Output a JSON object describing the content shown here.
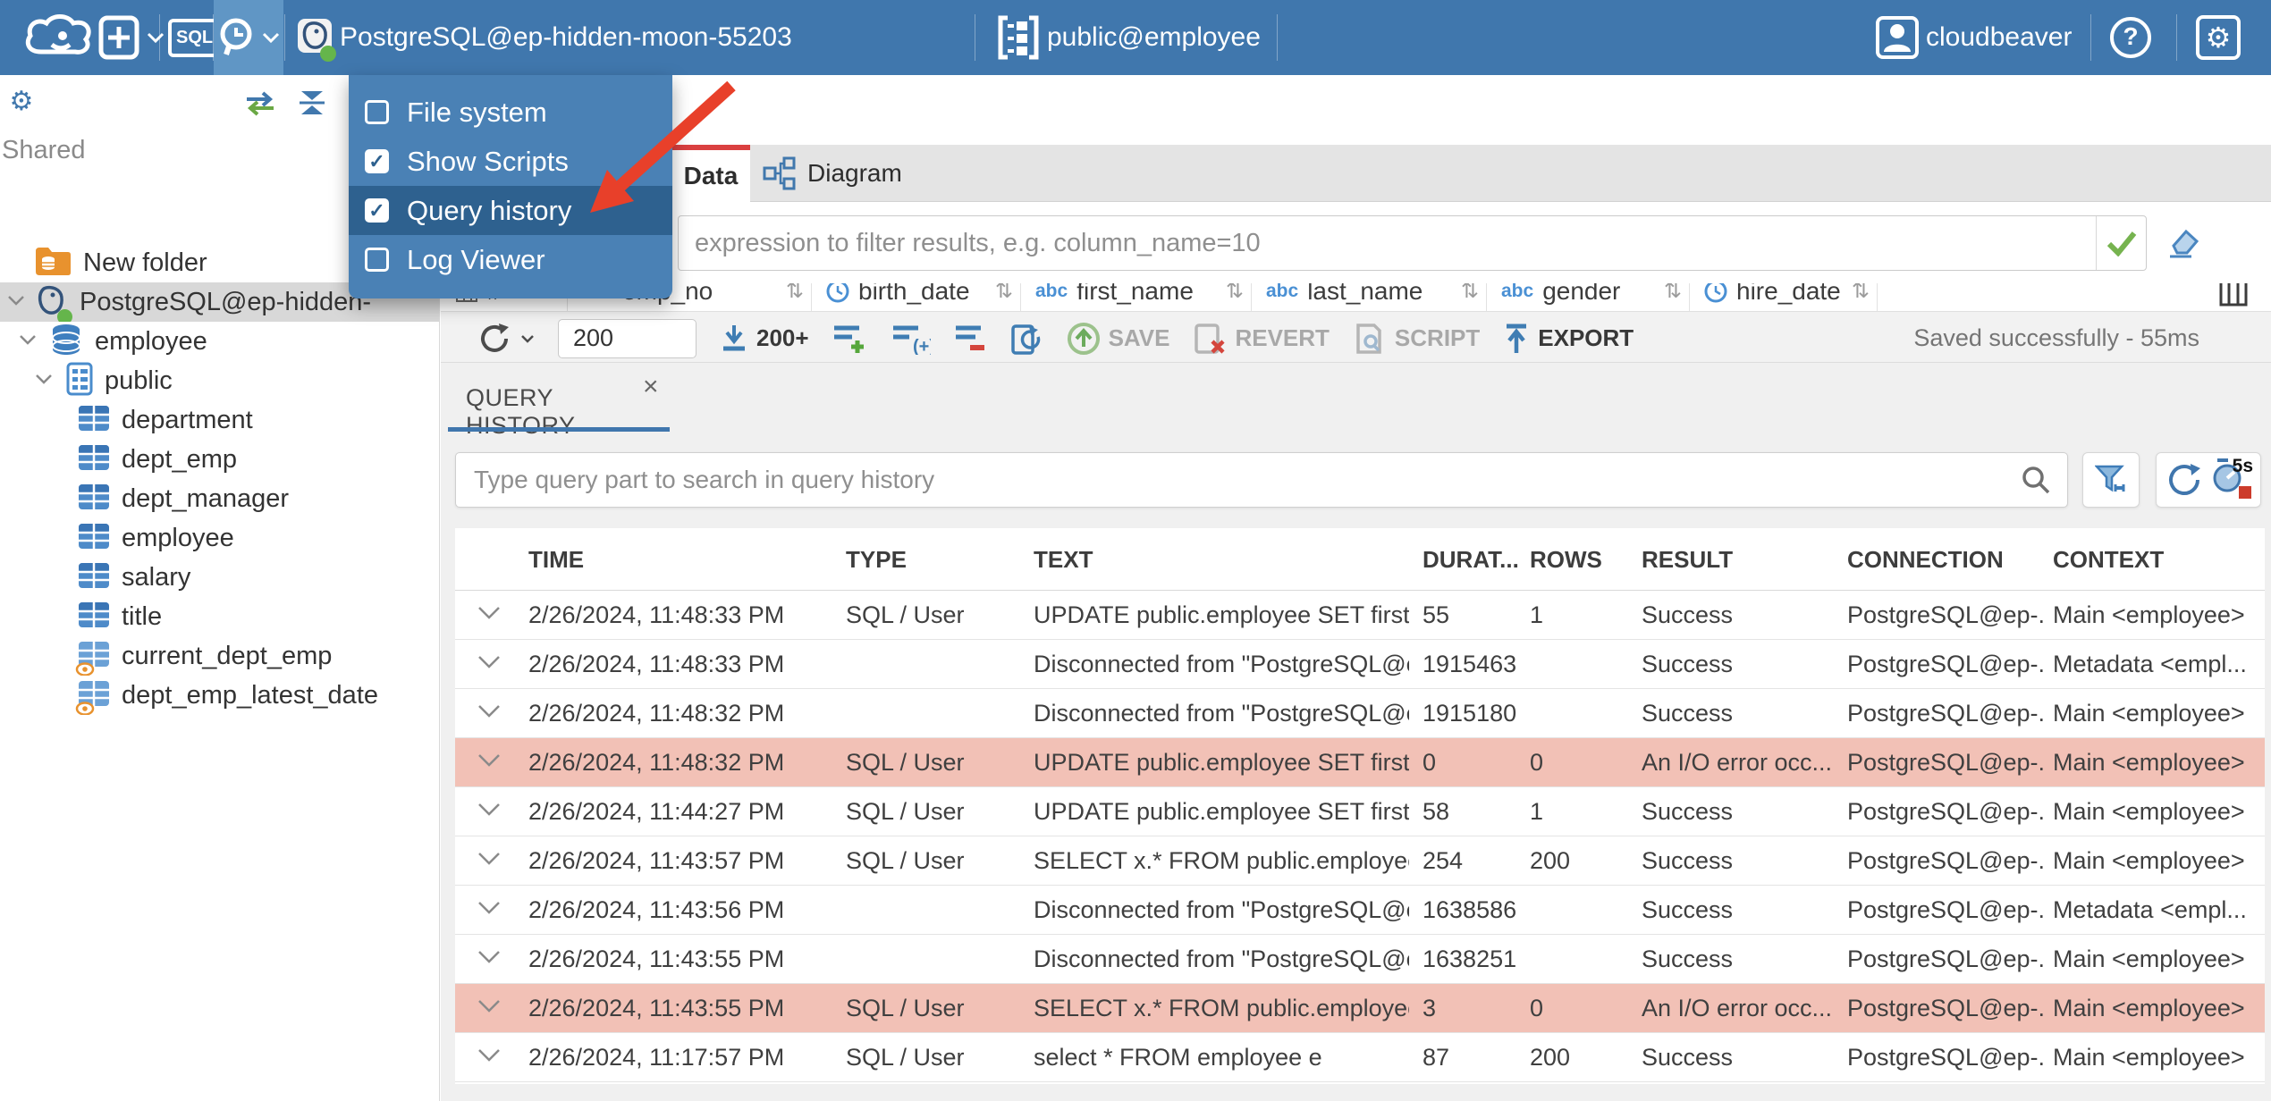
{
  "header": {
    "logo_title": "CloudBeaver",
    "sql_button": "SQL",
    "connection": "PostgreSQL@ep-hidden-moon-55203",
    "schema": "public@employee",
    "user": "cloudbeaver"
  },
  "tools_menu": {
    "items": [
      {
        "label": "File system",
        "checked": false,
        "highlighted": false
      },
      {
        "label": "Show Scripts",
        "checked": true,
        "highlighted": false
      },
      {
        "label": "Query history",
        "checked": true,
        "highlighted": true
      },
      {
        "label": "Log Viewer",
        "checked": false,
        "highlighted": false
      }
    ]
  },
  "sidebar": {
    "section": "Shared",
    "tree": [
      {
        "label": "New folder",
        "level": 1,
        "icon": "folder",
        "chevron": false,
        "selected": false
      },
      {
        "label": "PostgreSQL@ep-hidden-",
        "level": 1,
        "icon": "postgres",
        "chevron": true,
        "selected": true
      },
      {
        "label": "employee",
        "level": 2,
        "icon": "database",
        "chevron": true,
        "selected": false
      },
      {
        "label": "public",
        "level": 3,
        "icon": "schema",
        "chevron": true,
        "selected": false
      },
      {
        "label": "department",
        "level": 4,
        "icon": "table",
        "chevron": false,
        "selected": false
      },
      {
        "label": "dept_emp",
        "level": 4,
        "icon": "table",
        "chevron": false,
        "selected": false
      },
      {
        "label": "dept_manager",
        "level": 4,
        "icon": "table",
        "chevron": false,
        "selected": false
      },
      {
        "label": "employee",
        "level": 4,
        "icon": "table",
        "chevron": false,
        "selected": false
      },
      {
        "label": "salary",
        "level": 4,
        "icon": "table",
        "chevron": false,
        "selected": false
      },
      {
        "label": "title",
        "level": 4,
        "icon": "table",
        "chevron": false,
        "selected": false
      },
      {
        "label": "current_dept_emp",
        "level": 4,
        "icon": "view",
        "chevron": false,
        "selected": false
      },
      {
        "label": "dept_emp_latest_date",
        "level": 4,
        "icon": "view",
        "chevron": false,
        "selected": false
      }
    ]
  },
  "editor": {
    "tabs": {
      "data": "Data",
      "diagram": "Diagram"
    },
    "filter_placeholder": "expression to filter results, e.g. column_name=10",
    "grid_columns": [
      {
        "label": "#",
        "icon": "grid"
      },
      {
        "label": "emp_no",
        "icon": "123"
      },
      {
        "label": "birth_date",
        "icon": "clock"
      },
      {
        "label": "first_name",
        "icon": "abc"
      },
      {
        "label": "last_name",
        "icon": "abc"
      },
      {
        "label": "gender",
        "icon": "abc"
      },
      {
        "label": "hire_date",
        "icon": "clock"
      }
    ],
    "toolbar": {
      "row_limit": "200",
      "fetch_size_label": "200+",
      "save": "SAVE",
      "revert": "REVERT",
      "script": "SCRIPT",
      "export": "EXPORT",
      "status": "Saved successfully - 55ms"
    }
  },
  "query_history": {
    "tab": "QUERY HISTORY",
    "search_placeholder": "Type query part to search in query history",
    "auto_refresh": "5s",
    "columns": [
      "TIME",
      "TYPE",
      "TEXT",
      "DURAT...",
      "ROWS",
      "RESULT",
      "CONNECTION",
      "CONTEXT"
    ],
    "rows": [
      {
        "time": "2/26/2024, 11:48:33 PM",
        "type": "SQL / User",
        "text": "UPDATE public.employee SET first_...",
        "duration": "55",
        "rows": "1",
        "result": "Success",
        "connection": "PostgreSQL@ep-...",
        "context": "Main <employee>",
        "error": false
      },
      {
        "time": "2/26/2024, 11:48:33 PM",
        "type": "",
        "text": "Disconnected from \"PostgreSQL@e...",
        "duration": "1915463",
        "rows": "",
        "result": "Success",
        "connection": "PostgreSQL@ep-...",
        "context": "Metadata <empl...",
        "error": false
      },
      {
        "time": "2/26/2024, 11:48:32 PM",
        "type": "",
        "text": "Disconnected from \"PostgreSQL@e...",
        "duration": "1915180",
        "rows": "",
        "result": "Success",
        "connection": "PostgreSQL@ep-...",
        "context": "Main <employee>",
        "error": false
      },
      {
        "time": "2/26/2024, 11:48:32 PM",
        "type": "SQL / User",
        "text": "UPDATE public.employee SET first_...",
        "duration": "0",
        "rows": "0",
        "result": "An I/O error occ...",
        "connection": "PostgreSQL@ep-...",
        "context": "Main <employee>",
        "error": true
      },
      {
        "time": "2/26/2024, 11:44:27 PM",
        "type": "SQL / User",
        "text": "UPDATE public.employee SET first_...",
        "duration": "58",
        "rows": "1",
        "result": "Success",
        "connection": "PostgreSQL@ep-...",
        "context": "Main <employee>",
        "error": false
      },
      {
        "time": "2/26/2024, 11:43:57 PM",
        "type": "SQL / User",
        "text": "SELECT x.* FROM public.employee x",
        "duration": "254",
        "rows": "200",
        "result": "Success",
        "connection": "PostgreSQL@ep-...",
        "context": "Main <employee>",
        "error": false
      },
      {
        "time": "2/26/2024, 11:43:56 PM",
        "type": "",
        "text": "Disconnected from \"PostgreSQL@e...",
        "duration": "1638586",
        "rows": "",
        "result": "Success",
        "connection": "PostgreSQL@ep-...",
        "context": "Metadata <empl...",
        "error": false
      },
      {
        "time": "2/26/2024, 11:43:55 PM",
        "type": "",
        "text": "Disconnected from \"PostgreSQL@e...",
        "duration": "1638251",
        "rows": "",
        "result": "Success",
        "connection": "PostgreSQL@ep-...",
        "context": "Main <employee>",
        "error": false
      },
      {
        "time": "2/26/2024, 11:43:55 PM",
        "type": "SQL / User",
        "text": "SELECT x.* FROM public.employee x",
        "duration": "3",
        "rows": "0",
        "result": "An I/O error occ...",
        "connection": "PostgreSQL@ep-...",
        "context": "Main <employee>",
        "error": true
      },
      {
        "time": "2/26/2024, 11:17:57 PM",
        "type": "SQL / User",
        "text": "select * FROM employee e",
        "duration": "87",
        "rows": "200",
        "result": "Success",
        "connection": "PostgreSQL@ep-...",
        "context": "Main <employee>",
        "error": false
      }
    ]
  }
}
